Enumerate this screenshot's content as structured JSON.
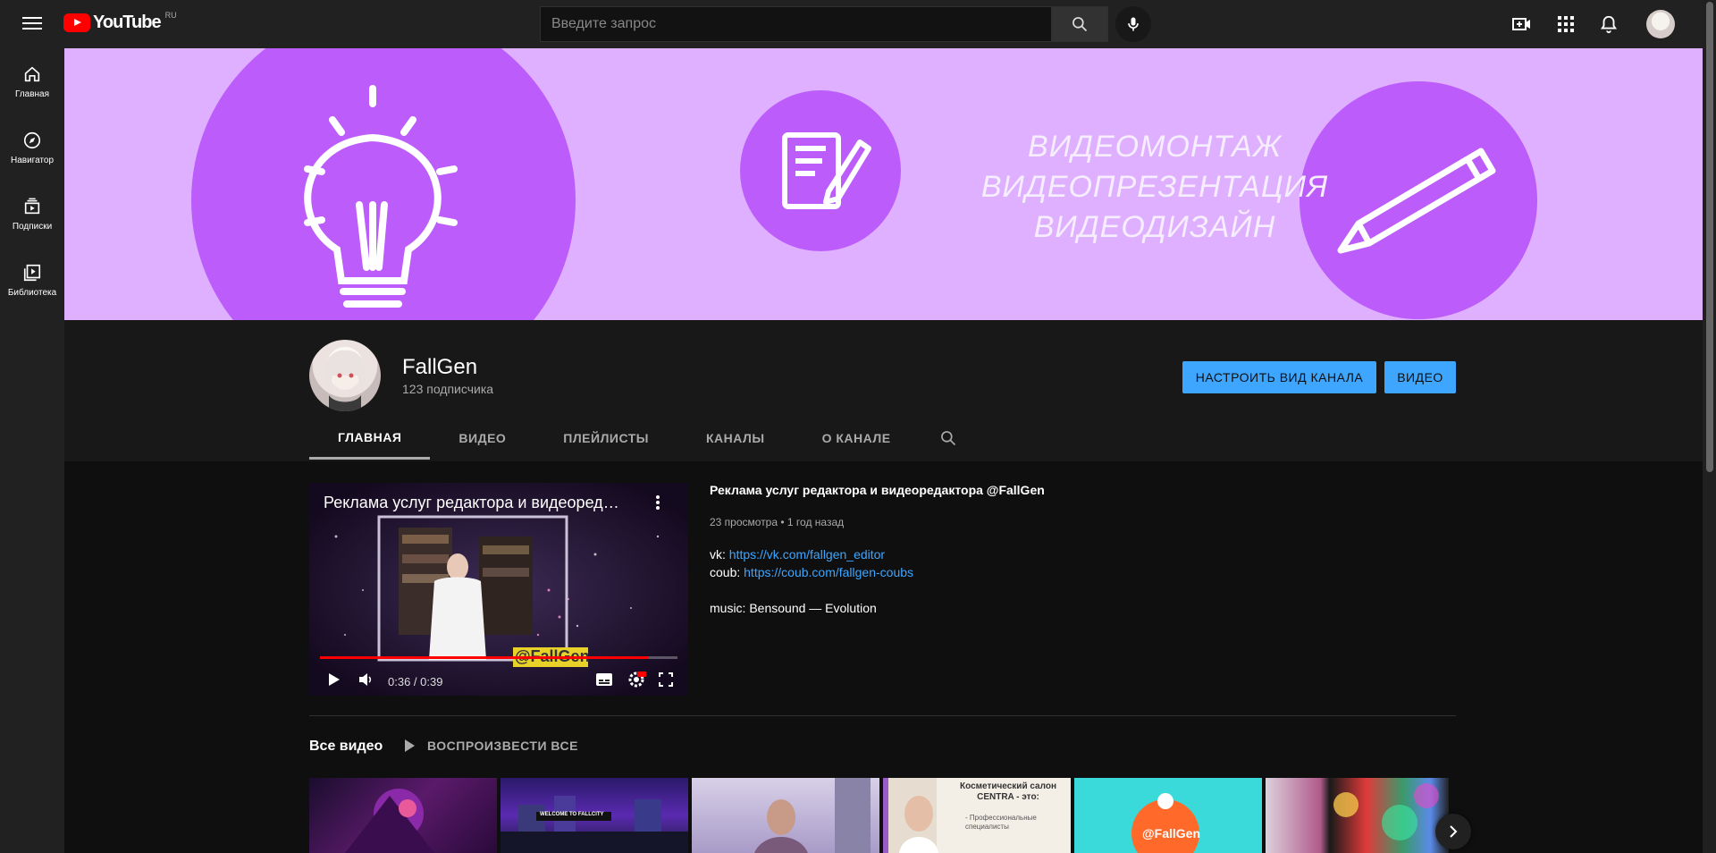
{
  "topbar": {
    "logo_text": "YouTube",
    "region": "RU",
    "search_placeholder": "Введите запрос"
  },
  "sidebar": {
    "items": [
      {
        "label": "Главная",
        "icon": "home-icon"
      },
      {
        "label": "Навигатор",
        "icon": "compass-icon"
      },
      {
        "label": "Подписки",
        "icon": "subscriptions-icon"
      },
      {
        "label": "Библиотека",
        "icon": "library-icon"
      }
    ]
  },
  "banner": {
    "lines": [
      "ВИДЕОМОНТАЖ",
      "ВИДЕОПРЕЗЕНТАЦИЯ",
      "ВИДЕОДИЗАЙН"
    ],
    "bg_color": "#dfb0ff",
    "circle_color": "#bc5cfb"
  },
  "channel": {
    "name": "FallGen",
    "subscribers": "123 подписчика",
    "customize_button": "НАСТРОИТЬ ВИД КАНАЛА",
    "video_button": "ВИДЕО",
    "accent": "#3ea6ff"
  },
  "tabs": [
    {
      "label": "ГЛАВНАЯ",
      "active": true
    },
    {
      "label": "ВИДЕО",
      "active": false
    },
    {
      "label": "ПЛЕЙЛИСТЫ",
      "active": false
    },
    {
      "label": "КАНАЛЫ",
      "active": false
    },
    {
      "label": "О КАНАЛЕ",
      "active": false
    }
  ],
  "featured": {
    "player_title": "Реклама услуг редактора и видеоредакт...",
    "time": "0:36 / 0:39",
    "progress": 0.92,
    "watermark": "@FallGen",
    "title": "Реклама услуг редактора и видеоредактора @FallGen",
    "views": "23 просмотра",
    "age": "1 год назад",
    "vk_label": "vk:",
    "vk_link": "https://vk.com/fallgen_editor",
    "coub_label": "coub:",
    "coub_link": "https://coub.com/fallgen-coubs",
    "music": "music: Bensound — Evolution"
  },
  "all_videos": {
    "title": "Все видео",
    "play_all": "ВОСПРОИЗВЕСТИ ВСЕ",
    "thumb4_title": "Косметический салон CENTRA - это:",
    "thumb4_sub": "- Профессиональные специалисты",
    "thumb5_text": "@FallGen",
    "thumb2_text": "WELCOME TO FALLCITY"
  }
}
